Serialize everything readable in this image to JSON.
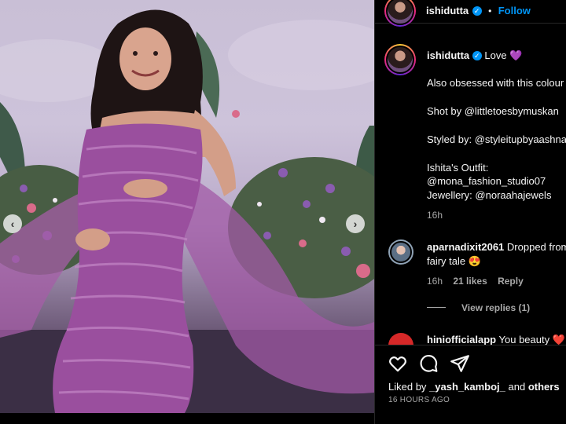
{
  "post": {
    "username": "ishidutta",
    "follow_label": "Follow",
    "separator": "•",
    "caption": {
      "first_line_rest": "Love 💜",
      "line2": "Also obsessed with this colour",
      "line3": "Shot by @littletoesbymuskan",
      "line4": "Styled by: @styleitupbyaashna",
      "line5": "Ishita's Outfit:",
      "line6": "@mona_fashion_studio07",
      "line7": "Jewellery: @noraahajewels",
      "time": "16h"
    },
    "comments": [
      {
        "username": "aparnadixit2061",
        "text_line1": "Dropped from",
        "text_line2": "fairy tale 😍",
        "time": "16h",
        "likes": "21 likes",
        "reply_label": "Reply",
        "view_replies": "View replies (1)"
      },
      {
        "username": "hiniofficialapp",
        "text_line1": "You beauty ❤️"
      }
    ],
    "liked_by_prefix": "Liked by",
    "liked_by_user": "_yash_kamboj_",
    "liked_by_and": "and",
    "liked_by_others": "others",
    "posted_ago": "16 HOURS AGO"
  },
  "colors": {
    "accent": "#0095f6",
    "muted": "#a8a8a8",
    "background": "#000000",
    "dress": "#9a4f9e"
  },
  "icons": [
    "heart-icon",
    "comment-icon",
    "share-icon",
    "chevron-left-icon",
    "chevron-right-icon",
    "verified-badge-icon"
  ]
}
